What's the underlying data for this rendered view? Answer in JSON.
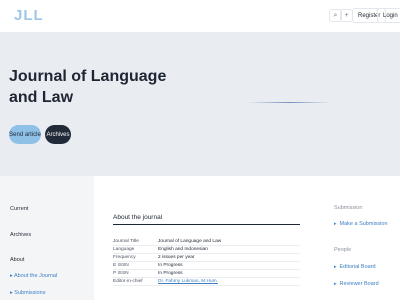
{
  "header": {
    "logo": "JLL",
    "register": "Register",
    "login": "Login",
    "search_icon": "search-icon",
    "plus_icon": "plus-icon",
    "search_glyph": "⌕",
    "plus_glyph": "+"
  },
  "hero": {
    "title": "Journal of Language and Law",
    "send_article": "Send article",
    "archives": "Archives"
  },
  "sidebar": {
    "items": [
      "Current",
      "Archives",
      "About"
    ],
    "subitems": [
      "About the Journal",
      "Submissions"
    ],
    "arrow": "▸"
  },
  "about": {
    "heading": "About the journal",
    "rows": [
      {
        "label": "Journal Title",
        "value": "Journal of Language and Law"
      },
      {
        "label": "Language",
        "value": "English and Indonesian"
      },
      {
        "label": "Frequency",
        "value": "2 issues per year"
      },
      {
        "label": "E ISSN",
        "value": "In Progress"
      },
      {
        "label": "P ISSN",
        "value": "In Progress"
      },
      {
        "label": "Editor-in-chief",
        "value": "Dr. Fahmy Lukman, M.Hum."
      }
    ]
  },
  "right_sidebar": {
    "submission_heading": "Submission",
    "make_submission": "Make a Submission",
    "people_heading": "People",
    "editorial_board": "Editorial Board",
    "reviewer_board": "Reviewer Board",
    "arrow": "▸"
  },
  "colors": {
    "accent_blue": "#8fc0e6",
    "dark": "#212a38",
    "link": "#3e7fc4",
    "hero_bg": "#e9ecf1",
    "sidebar_bg": "#f4f5f7"
  }
}
